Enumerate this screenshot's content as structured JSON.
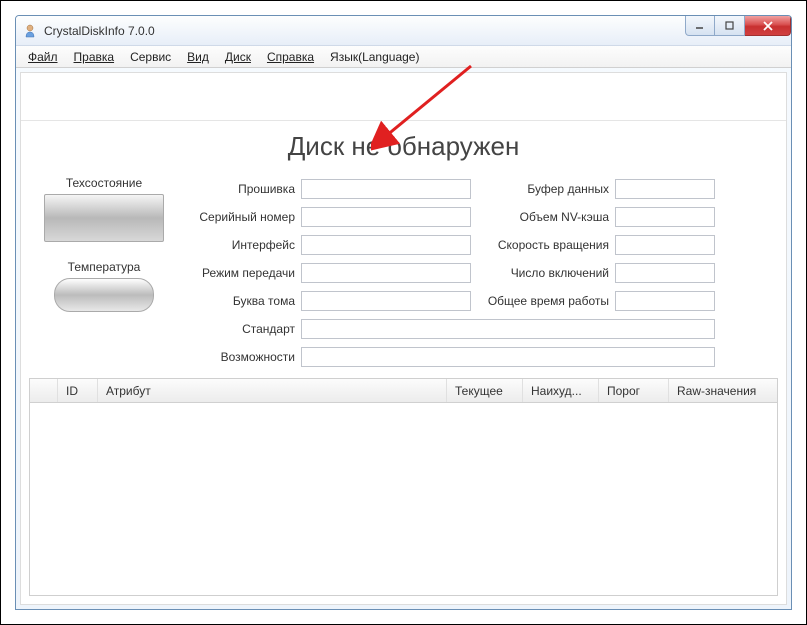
{
  "window": {
    "title": "CrystalDiskInfo 7.0.0"
  },
  "menu": {
    "file": "Файл",
    "edit": "Правка",
    "service": "Сервис",
    "view": "Вид",
    "disk": "Диск",
    "help": "Справка",
    "lang": "Язык(Language)"
  },
  "heading": "Диск не обнаружен",
  "left": {
    "status_label": "Техсостояние",
    "temp_label": "Температура"
  },
  "fields": {
    "firmware_label": "Прошивка",
    "firmware_value": "",
    "serial_label": "Серийный номер",
    "serial_value": "",
    "interface_label": "Интерфейс",
    "interface_value": "",
    "transfer_label": "Режим передачи",
    "transfer_value": "",
    "drive_label": "Буква тома",
    "drive_value": "",
    "standard_label": "Стандарт",
    "standard_value": "",
    "features_label": "Возможности",
    "features_value": "",
    "buffer_label": "Буфер данных",
    "buffer_value": "",
    "nvcache_label": "Объем NV-кэша",
    "nvcache_value": "",
    "rotation_label": "Скорость вращения",
    "rotation_value": "",
    "poweron_label": "Число включений",
    "poweron_value": "",
    "hours_label": "Общее время работы",
    "hours_value": ""
  },
  "table": {
    "col_blank": "",
    "col_id": "ID",
    "col_attr": "Атрибут",
    "col_current": "Текущее",
    "col_worst": "Наихуд...",
    "col_threshold": "Порог",
    "col_raw": "Raw-значения"
  }
}
